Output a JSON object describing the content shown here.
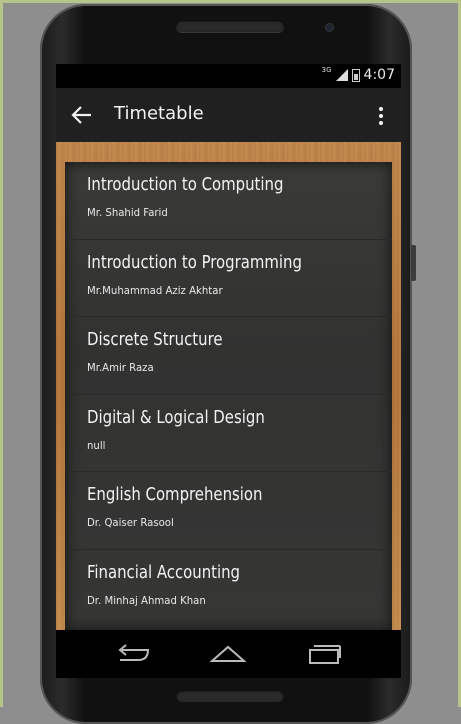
{
  "colors": {
    "toolbar": "#202020",
    "board": "#363635",
    "frame_wood": "#c08748",
    "background": "#8e8e8e"
  },
  "status": {
    "network": "3G",
    "time": "4:07"
  },
  "toolbar": {
    "title": "Timetable",
    "back_icon": "arrow-left-icon",
    "menu_icon": "more-vert-icon"
  },
  "courses": [
    {
      "name": "Introduction to Computing",
      "teacher": "Mr. Shahid Farid"
    },
    {
      "name": "Introduction to Programming",
      "teacher": "Mr.Muhammad Aziz Akhtar"
    },
    {
      "name": "Discrete Structure",
      "teacher": "Mr.Amir Raza"
    },
    {
      "name": "Digital & Logical Design",
      "teacher": "null"
    },
    {
      "name": "English Comprehension",
      "teacher": "Dr. Qaiser Rasool"
    },
    {
      "name": "Financial Accounting",
      "teacher": "Dr. Minhaj Ahmad Khan"
    }
  ],
  "navbar": {
    "back_icon": "nav-back-icon",
    "home_icon": "nav-home-icon",
    "recents_icon": "nav-recents-icon"
  }
}
